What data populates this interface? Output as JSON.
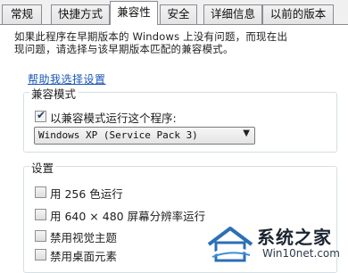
{
  "tabs": [
    {
      "label": "常规"
    },
    {
      "label": "快捷方式"
    },
    {
      "label": "兼容性"
    },
    {
      "label": "安全"
    },
    {
      "label": "详细信息"
    },
    {
      "label": "以前的版本"
    }
  ],
  "active_tab": "兼容性",
  "intro": {
    "line1": "如果此程序在早期版本的 Windows 上没有问题，而现在出",
    "line2": "现问题，请选择与该早期版本匹配的兼容模式。"
  },
  "help_link": "帮助我选择设置",
  "compat_group": {
    "title": "兼容模式",
    "checkbox_label": "以兼容模式运行这个程序:",
    "checked": true,
    "selected_os": "Windows XP (Service Pack 3)"
  },
  "settings_group": {
    "title": "设置",
    "options": [
      {
        "label": "用 256 色运行",
        "checked": false
      },
      {
        "label": "用 640 × 480 屏幕分辨率运行",
        "checked": false
      },
      {
        "label": "禁用视觉主题",
        "checked": false
      },
      {
        "label": "禁用桌面元素",
        "checked": false
      }
    ]
  },
  "watermark": {
    "brand": "系统之家",
    "url": "Win10net.com"
  },
  "colors": {
    "link": "#1a56b8",
    "tab_border": "#898c95",
    "group_border": "#d5dfe5",
    "checkmark": "#26366a"
  }
}
